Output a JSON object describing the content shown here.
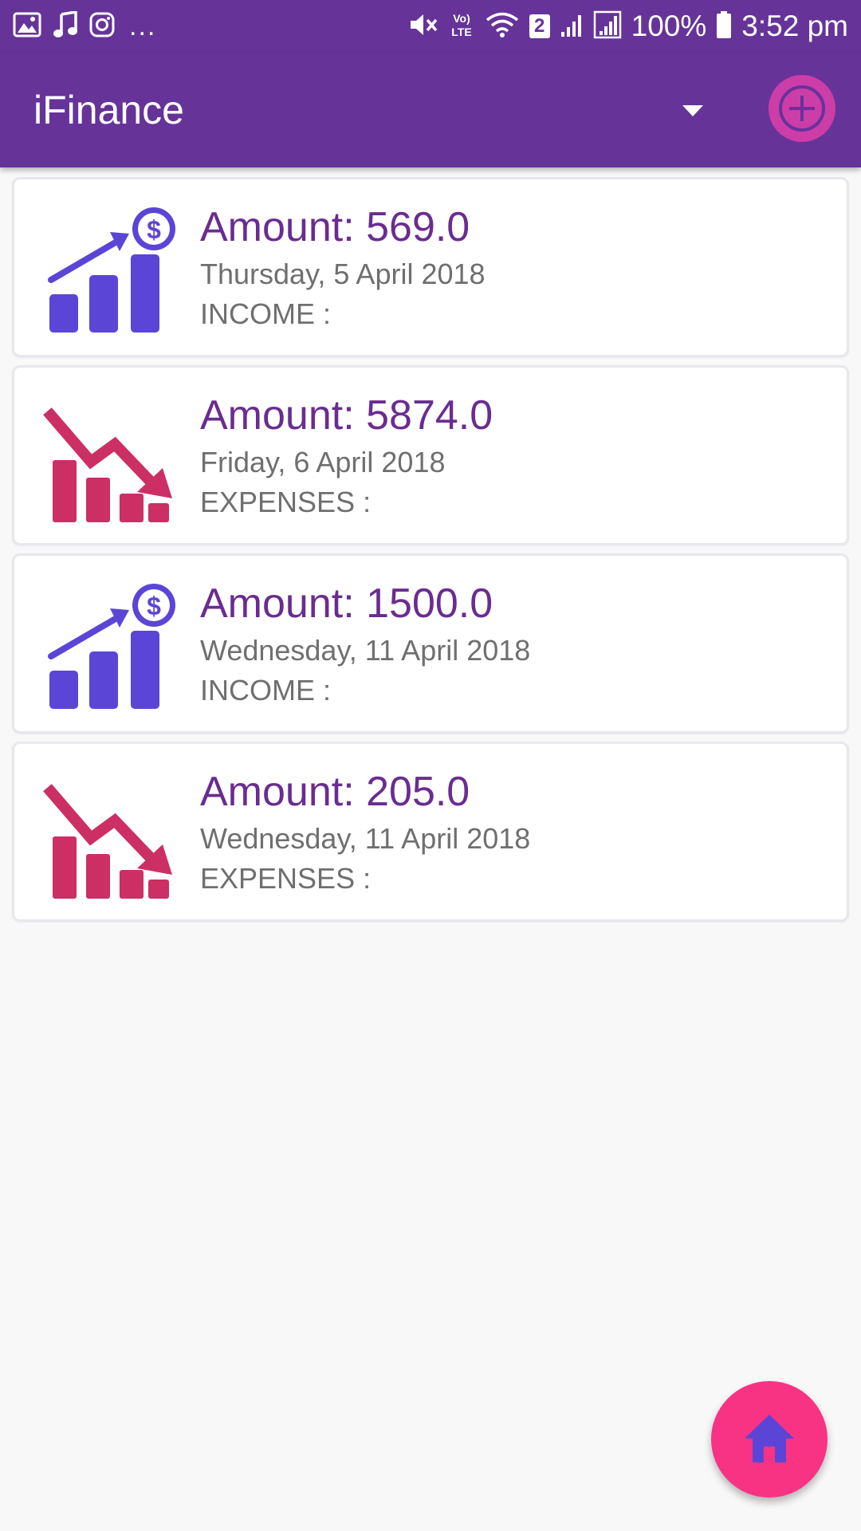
{
  "status_bar": {
    "overflow": "...",
    "sim_badge": "2",
    "battery_percent": "100%",
    "time": "3:52 pm",
    "icons": [
      "image-icon",
      "music-icon",
      "instagram-icon",
      "mute-icon",
      "volte-icon",
      "wifi-icon",
      "signal-icon",
      "signal-icon",
      "battery-icon"
    ]
  },
  "app_bar": {
    "title": "iFinance",
    "icons": [
      "dropdown-arrow-icon",
      "add-icon"
    ]
  },
  "transactions": [
    {
      "amount": "Amount: 569.0",
      "date": "Thursday, 5 April 2018",
      "type": "INCOME :",
      "icon": "income-chart-icon"
    },
    {
      "amount": "Amount: 5874.0",
      "date": "Friday, 6 April 2018",
      "type": "EXPENSES :",
      "icon": "expense-chart-icon"
    },
    {
      "amount": "Amount: 1500.0",
      "date": "Wednesday, 11 April 2018",
      "type": "INCOME :",
      "icon": "income-chart-icon"
    },
    {
      "amount": "Amount: 205.0",
      "date": "Wednesday, 11 April 2018",
      "type": "EXPENSES :",
      "icon": "expense-chart-icon"
    }
  ],
  "fab": {
    "icon": "home-icon"
  },
  "colors": {
    "app_bar": "#663399",
    "add_button": "#cc3da8",
    "amount_text": "#6a2c91",
    "income_icon": "#5b45d6",
    "expense_icon": "#cc2f64",
    "home_fab": "#f83383",
    "home_icon": "#5b45d6"
  }
}
